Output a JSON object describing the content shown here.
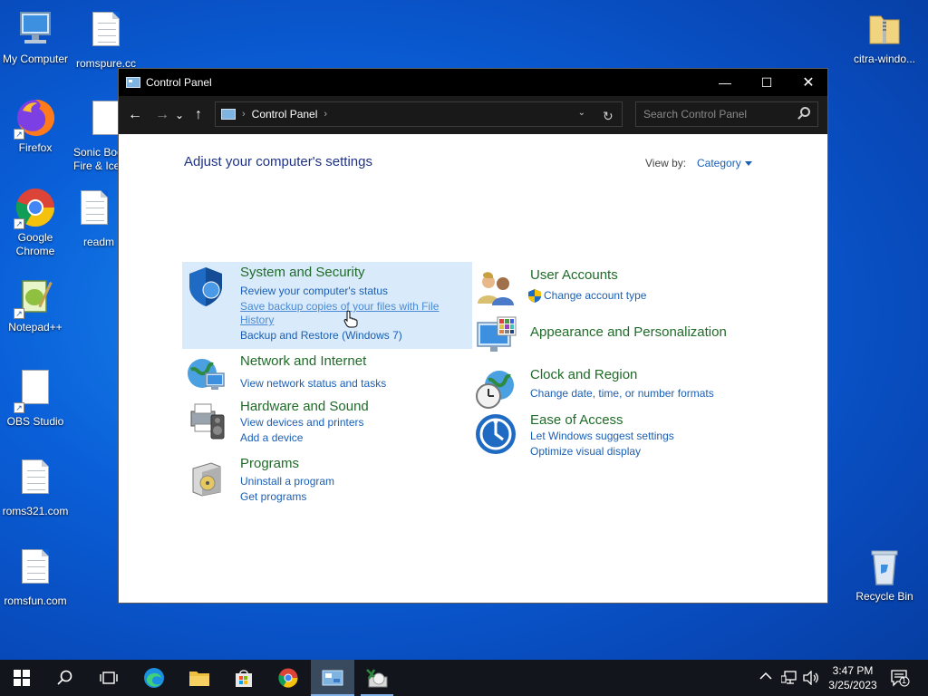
{
  "desktop": {
    "icons": [
      {
        "label": "My Computer"
      },
      {
        "label": "romspure.cc"
      },
      {
        "label": "Firefox"
      },
      {
        "label": "Sonic Boo Fire & Ice"
      },
      {
        "label": "Google Chrome"
      },
      {
        "label": "readm"
      },
      {
        "label": "Notepad++"
      },
      {
        "label": "OBS Studio"
      },
      {
        "label": "roms321.com"
      },
      {
        "label": "romsfun.com"
      },
      {
        "label": "citra-windo..."
      },
      {
        "label": "Recycle Bin"
      }
    ]
  },
  "window": {
    "title": "Control Panel",
    "minimize": "—",
    "maximize": "☐",
    "close": "✕"
  },
  "navbar": {
    "back": "←",
    "forward": "→",
    "recent": "⌄",
    "up": "↑",
    "breadcrumb": "Control Panel",
    "sep": "›",
    "dropdown": "⌄",
    "refresh": "↻",
    "search_placeholder": "Search Control Panel"
  },
  "content": {
    "heading": "Adjust your computer's settings",
    "view_by_label": "View by:",
    "view_by_value": "Category"
  },
  "categories": {
    "system": {
      "title": "System and Security",
      "links": [
        "Review your computer's status",
        "Save backup copies of your files with File",
        "History",
        "Backup and Restore (Windows 7)"
      ]
    },
    "network": {
      "title": "Network and Internet",
      "links": [
        "View network status and tasks"
      ]
    },
    "hardware": {
      "title": "Hardware and Sound",
      "links": [
        "View devices and printers",
        "Add a device"
      ]
    },
    "programs": {
      "title": "Programs",
      "links": [
        "Uninstall a program",
        "Get programs"
      ]
    },
    "users": {
      "title": "User Accounts",
      "links": [
        "Change account type"
      ]
    },
    "appearance": {
      "title": "Appearance and Personalization"
    },
    "clock": {
      "title": "Clock and Region",
      "links": [
        "Change date, time, or number formats"
      ]
    },
    "ease": {
      "title": "Ease of Access",
      "links": [
        "Let Windows suggest settings",
        "Optimize visual display"
      ]
    }
  },
  "taskbar": {
    "time": "3:47 PM",
    "date": "3/25/2023",
    "notification_count": "1"
  },
  "colors": {
    "link": "#1a5fb4",
    "category_title": "#1f6b28",
    "highlight": "#d9ebfb",
    "titlebar": "#000000"
  }
}
